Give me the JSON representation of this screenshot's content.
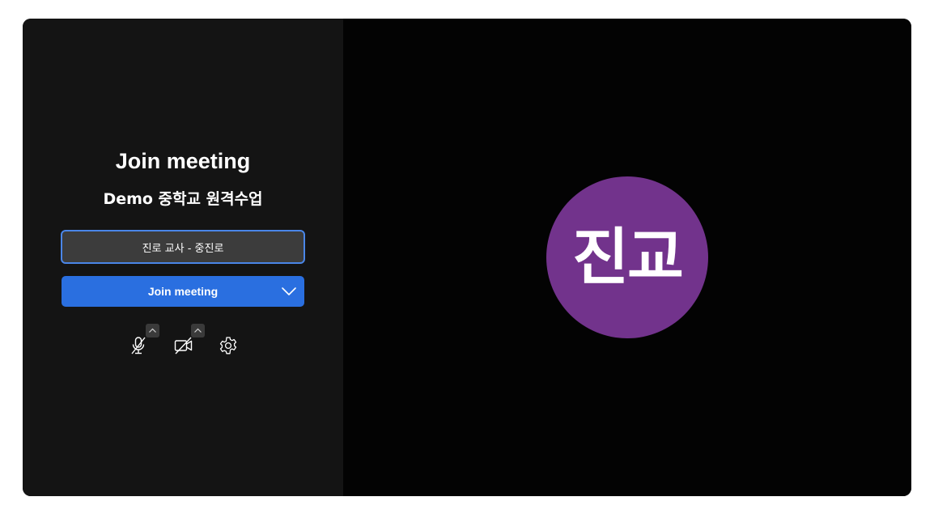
{
  "prejoin": {
    "title": "Join meeting",
    "meeting_name": "Demo 중학교 원격수업",
    "name_input": {
      "value": "진로 교사 - 중진로"
    },
    "join_button": {
      "label": "Join meeting"
    },
    "controls": {
      "mic_icon": "mic-off-icon",
      "camera_icon": "camera-off-icon",
      "settings_icon": "gear-icon"
    }
  },
  "preview": {
    "avatar_initials": "진교",
    "avatar_color": "#72338c"
  },
  "colors": {
    "panel_bg": "#141414",
    "preview_bg": "#030303",
    "accent": "#2a6fe0",
    "input_border": "#4a86e8"
  }
}
